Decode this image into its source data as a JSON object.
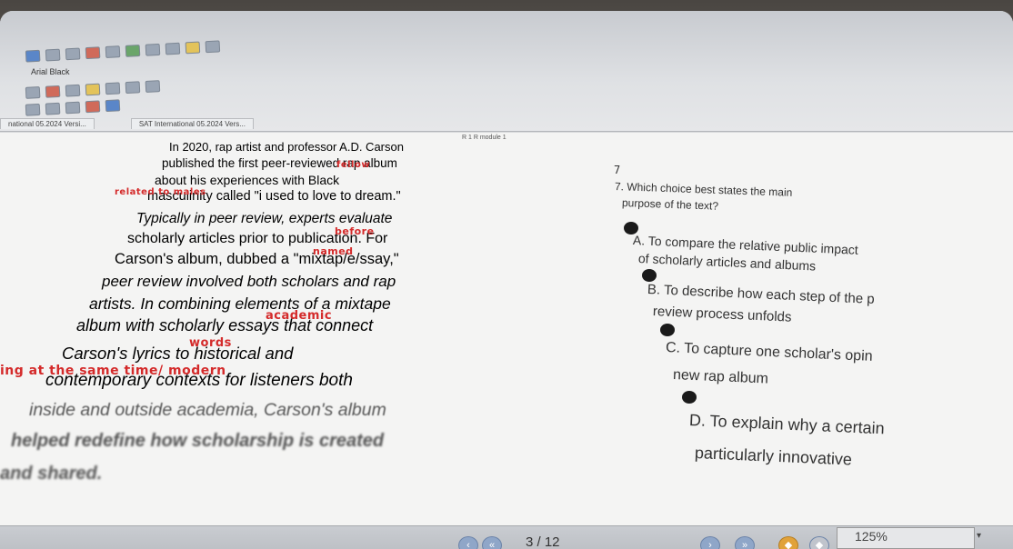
{
  "toolbar": {
    "font_name": "Arial Black",
    "document_tabs": [
      "national 05.2024 Versi...",
      "SAT International 05.2024 Vers..."
    ],
    "module_label": "R 1 R module 1"
  },
  "passage": {
    "lines": [
      "In 2020, rap artist and professor A.D. Carson",
      "published the first peer-reviewed rap album",
      "about          his          experiences          with          Black",
      "masculinity called \"i used to love to dream.\"",
      "Typically in peer review, experts evaluate",
      "scholarly articles prior to publication. For",
      "Carson's album, dubbed a \"mixtap/e/ssay,\"",
      "peer review involved both scholars and rap",
      "artists. In combining elements of a mixtape",
      "album with scholarly essays that connect",
      "Carson's        lyrics        to        historical        and",
      "contemporary contexts for listeners both",
      "inside and outside academia, Carson's album",
      "helped redefine how scholarship is created",
      "and shared."
    ],
    "annotations": {
      "fellow": "fellow",
      "related": "related to males",
      "before": "before",
      "named": "named",
      "academic": "academic",
      "words": "words",
      "same_time": "ing at the same time/ modern"
    }
  },
  "question": {
    "number": "7",
    "prompt_line1": "7. Which choice best states the main",
    "prompt_line2": "purpose of the text?",
    "choices": [
      {
        "line1": "A. To compare the relative public impact",
        "line2": "of scholarly articles and albums"
      },
      {
        "line1": "B. To describe how each step of the p",
        "line2": "review process unfolds"
      },
      {
        "line1": "C. To capture one scholar's opin",
        "line2": "new rap album"
      },
      {
        "line1": "D. To explain why a certain",
        "line2": "particularly innovative"
      }
    ]
  },
  "statusbar": {
    "page_counter": "3 / 12",
    "zoom": "125%"
  },
  "colors": {
    "annotation_red": "#d42a2a",
    "page_bg": "#f4f4f3"
  }
}
